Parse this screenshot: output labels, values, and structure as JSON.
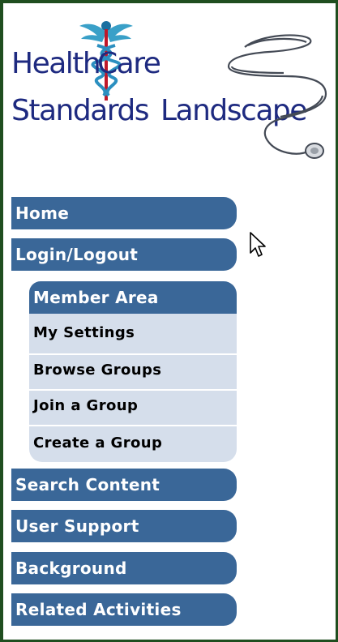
{
  "logo": {
    "word1": "Health",
    "word2": "Care",
    "word3": "Standards",
    "word4": "Landscape",
    "text_color": "#1e2a80"
  },
  "nav": {
    "home": "Home",
    "login_logout": "Login/Logout",
    "member_area": {
      "title": "Member Area",
      "items": [
        "My Settings",
        "Browse Groups",
        "Join a Group",
        "Create a Group"
      ]
    },
    "search_content": "Search Content",
    "user_support": "User Support",
    "background": "Background",
    "related_activities": "Related Activities"
  },
  "colors": {
    "tab_bg": "#3a6798",
    "submenu_bg": "#d5deeb",
    "border": "#1f4e1f"
  },
  "icons": {
    "cursor": "mouse-pointer-icon"
  }
}
